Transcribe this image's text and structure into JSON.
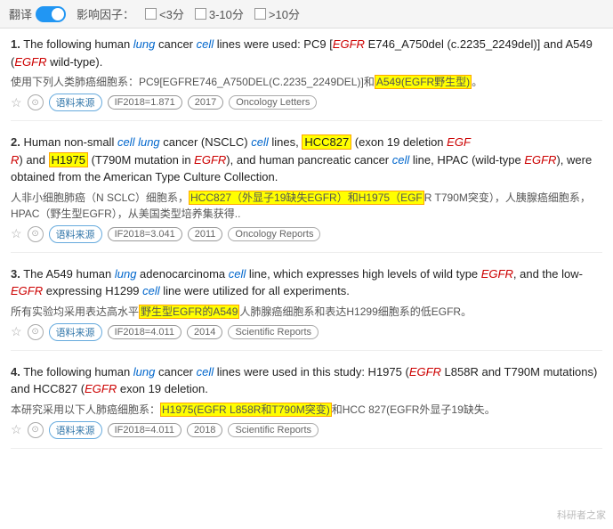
{
  "topbar": {
    "translate_label": "翻译",
    "impact_label": "影响因子：",
    "filter1": "<3分",
    "filter2": "3-10分",
    "filter3": ">10分"
  },
  "results": [
    {
      "number": "1.",
      "english_parts": [
        {
          "text": "The following human "
        },
        {
          "text": "lung",
          "style": "blue-italic"
        },
        {
          "text": " cancer "
        },
        {
          "text": "cell",
          "style": "blue-italic"
        },
        {
          "text": " lines were used: PC9 ["
        },
        {
          "text": "EGFR",
          "style": "red-italic"
        },
        {
          "text": " E746_A750del (c.2235_2249del)] and A549 ("
        },
        {
          "text": "EGFR",
          "style": "red-italic"
        },
        {
          "text": " wild-type)."
        }
      ],
      "chinese_parts": [
        {
          "text": "使用下列人类肺癌细胞系：PC9[EGFRE746_A750DEL(C.2235_2249DEL)]和"
        },
        {
          "text": "A549(EGFR野生型)",
          "style": "highlight"
        },
        {
          "text": "。"
        }
      ],
      "if_value": "IF2018=1.871",
      "year": "2017",
      "journal": "Oncology Letters"
    },
    {
      "number": "2.",
      "english_parts": [
        {
          "text": "Human non-small "
        },
        {
          "text": "cell lung",
          "style": "blue-italic"
        },
        {
          "text": " cancer (NSCLC) "
        },
        {
          "text": "cell",
          "style": "blue-italic"
        },
        {
          "text": " lines, "
        },
        {
          "text": "HCC827",
          "style": "highlight"
        },
        {
          "text": " (exon 19 deletion "
        },
        {
          "text": "EGF\nR",
          "style": "red-italic"
        },
        {
          "text": ") and "
        },
        {
          "text": "H1975",
          "style": "highlight"
        },
        {
          "text": " (T790M mutation in "
        },
        {
          "text": "EGFR",
          "style": "red-italic"
        },
        {
          "text": "), and human pancreatic cancer "
        },
        {
          "text": "cell",
          "style": "blue-italic"
        },
        {
          "text": " line, HPAC (wild-type "
        },
        {
          "text": "EGFR",
          "style": "red-italic"
        },
        {
          "text": "), were obtained from the American Type Culture Collection."
        }
      ],
      "chinese_parts": [
        {
          "text": "人非小细胞肺癌（N SCLC）细胞系，"
        },
        {
          "text": "HCC827（外显子19缺失EGFR）和H1975（EGF",
          "style": "highlight"
        },
        {
          "text": "R T790M突变），人胰腺癌细胞系，HPAC（野生型EGFR），从美国类型培养集获得.."
        }
      ],
      "if_value": "IF2018=3.041",
      "year": "2011",
      "journal": "Oncology Reports"
    },
    {
      "number": "3.",
      "english_parts": [
        {
          "text": "The A549 human "
        },
        {
          "text": "lung",
          "style": "blue-italic"
        },
        {
          "text": " adenocarcinoma "
        },
        {
          "text": "cell",
          "style": "blue-italic"
        },
        {
          "text": " line, which expresses high levels of wild type "
        },
        {
          "text": "EGFR",
          "style": "red-italic"
        },
        {
          "text": ", and the low-"
        },
        {
          "text": "EGFR",
          "style": "red-italic"
        },
        {
          "text": " expressing H1299 "
        },
        {
          "text": "cell",
          "style": "blue-italic"
        },
        {
          "text": " line were utilized for all experiments."
        }
      ],
      "chinese_parts": [
        {
          "text": "所有实验均采用表达高水平"
        },
        {
          "text": "野生型EGFR的A549",
          "style": "highlight"
        },
        {
          "text": "人肺腺癌细胞系和表达H1299细胞系的低EGFR。"
        }
      ],
      "if_value": "IF2018=4.011",
      "year": "2014",
      "journal": "Scientific Reports"
    },
    {
      "number": "4.",
      "english_parts": [
        {
          "text": "The following human "
        },
        {
          "text": "lung",
          "style": "blue-italic"
        },
        {
          "text": " cancer "
        },
        {
          "text": "cell",
          "style": "blue-italic"
        },
        {
          "text": " lines were used in this study: H1975 ("
        },
        {
          "text": "EGFR",
          "style": "red-italic"
        },
        {
          "text": " L858R and T790M mutations) and HCC827 ("
        },
        {
          "text": "EGFR",
          "style": "red-italic"
        },
        {
          "text": " exon 19 deletion."
        }
      ],
      "chinese_parts": [
        {
          "text": "本研究采用以下人肺癌细胞系："
        },
        {
          "text": "H1975(EGFR L858R和T790M突变)",
          "style": "highlight"
        },
        {
          "text": "和HCC 827(EGFR外显子19缺失。"
        }
      ],
      "if_value": "IF2018=4.011",
      "year": "2018",
      "journal": "Scientific Reports"
    }
  ],
  "watermark": "科研者之家"
}
